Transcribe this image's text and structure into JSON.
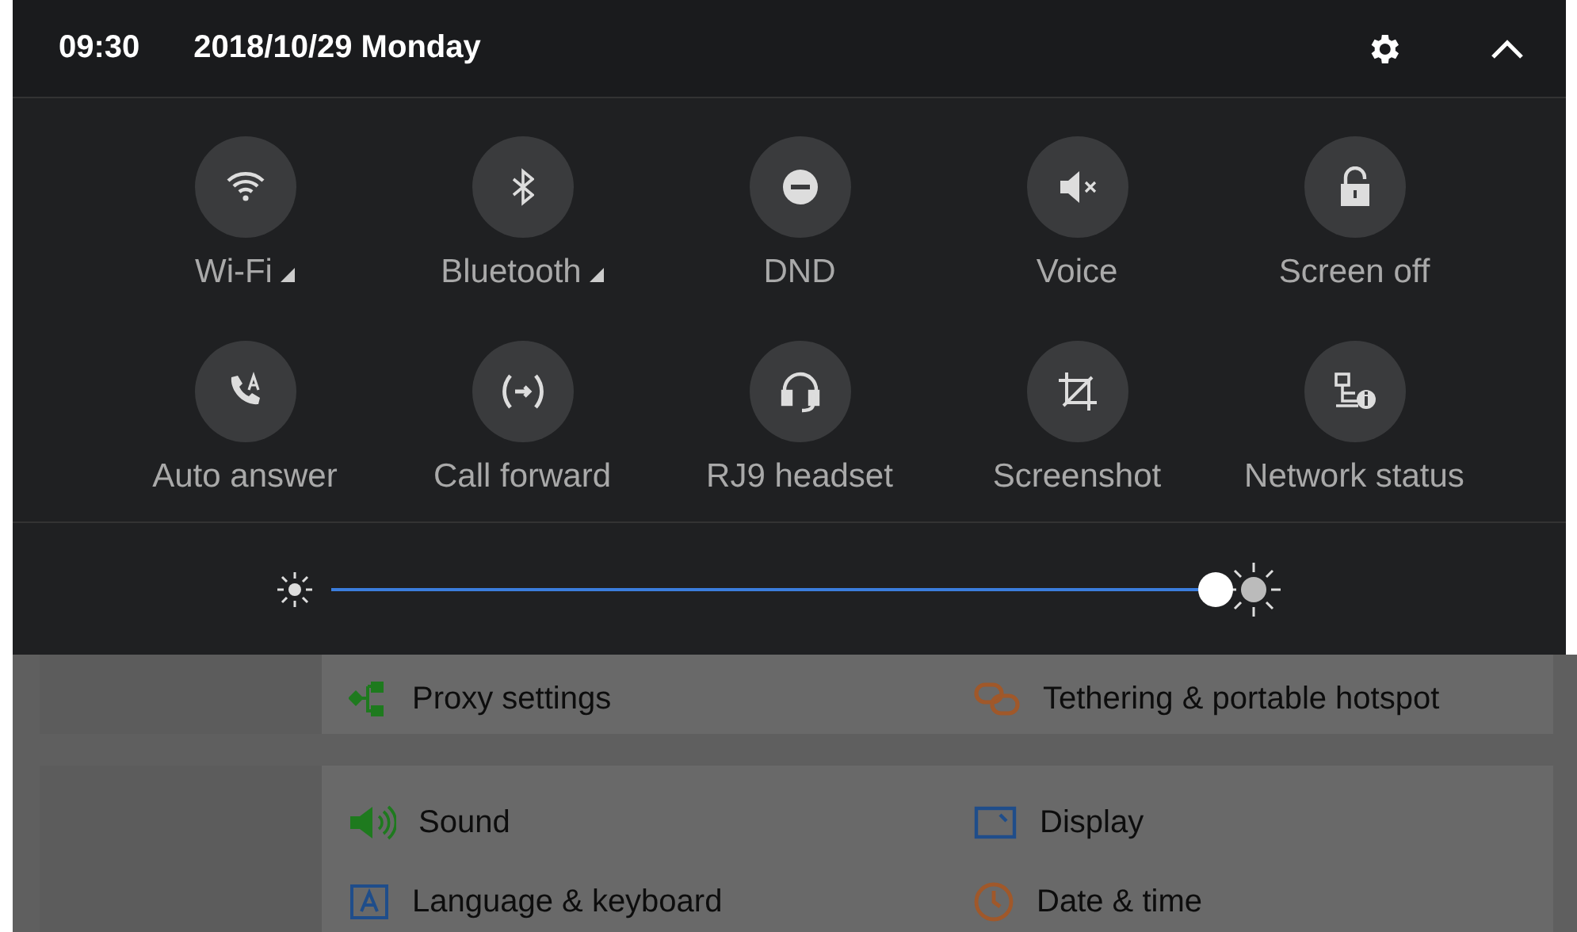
{
  "header": {
    "time": "09:30",
    "date": "2018/10/29 Monday"
  },
  "tiles": [
    {
      "label": "Wi-Fi",
      "on": false,
      "expandable": true
    },
    {
      "label": "Bluetooth",
      "on": false,
      "expandable": true
    },
    {
      "label": "DND",
      "on": false,
      "expandable": false
    },
    {
      "label": "Voice",
      "on": false,
      "expandable": false
    },
    {
      "label": "Screen off",
      "on": false,
      "expandable": false
    },
    {
      "label": "Auto answer",
      "on": false,
      "expandable": false
    },
    {
      "label": "Call forward",
      "on": false,
      "expandable": false
    },
    {
      "label": "RJ9 headset",
      "on": false,
      "expandable": false
    },
    {
      "label": "Screenshot",
      "on": false,
      "expandable": false
    },
    {
      "label": "Network status",
      "on": false,
      "expandable": false
    }
  ],
  "brightness": {
    "level": 1
  },
  "settings_cards": [
    {
      "items": [
        {
          "label": "Proxy settings"
        },
        {
          "label": "Tethering & portable hotspot"
        }
      ]
    },
    {
      "items": [
        {
          "label": "Sound"
        },
        {
          "label": "Display"
        },
        {
          "label": "Language & keyboard"
        },
        {
          "label": "Date & time"
        }
      ]
    }
  ]
}
